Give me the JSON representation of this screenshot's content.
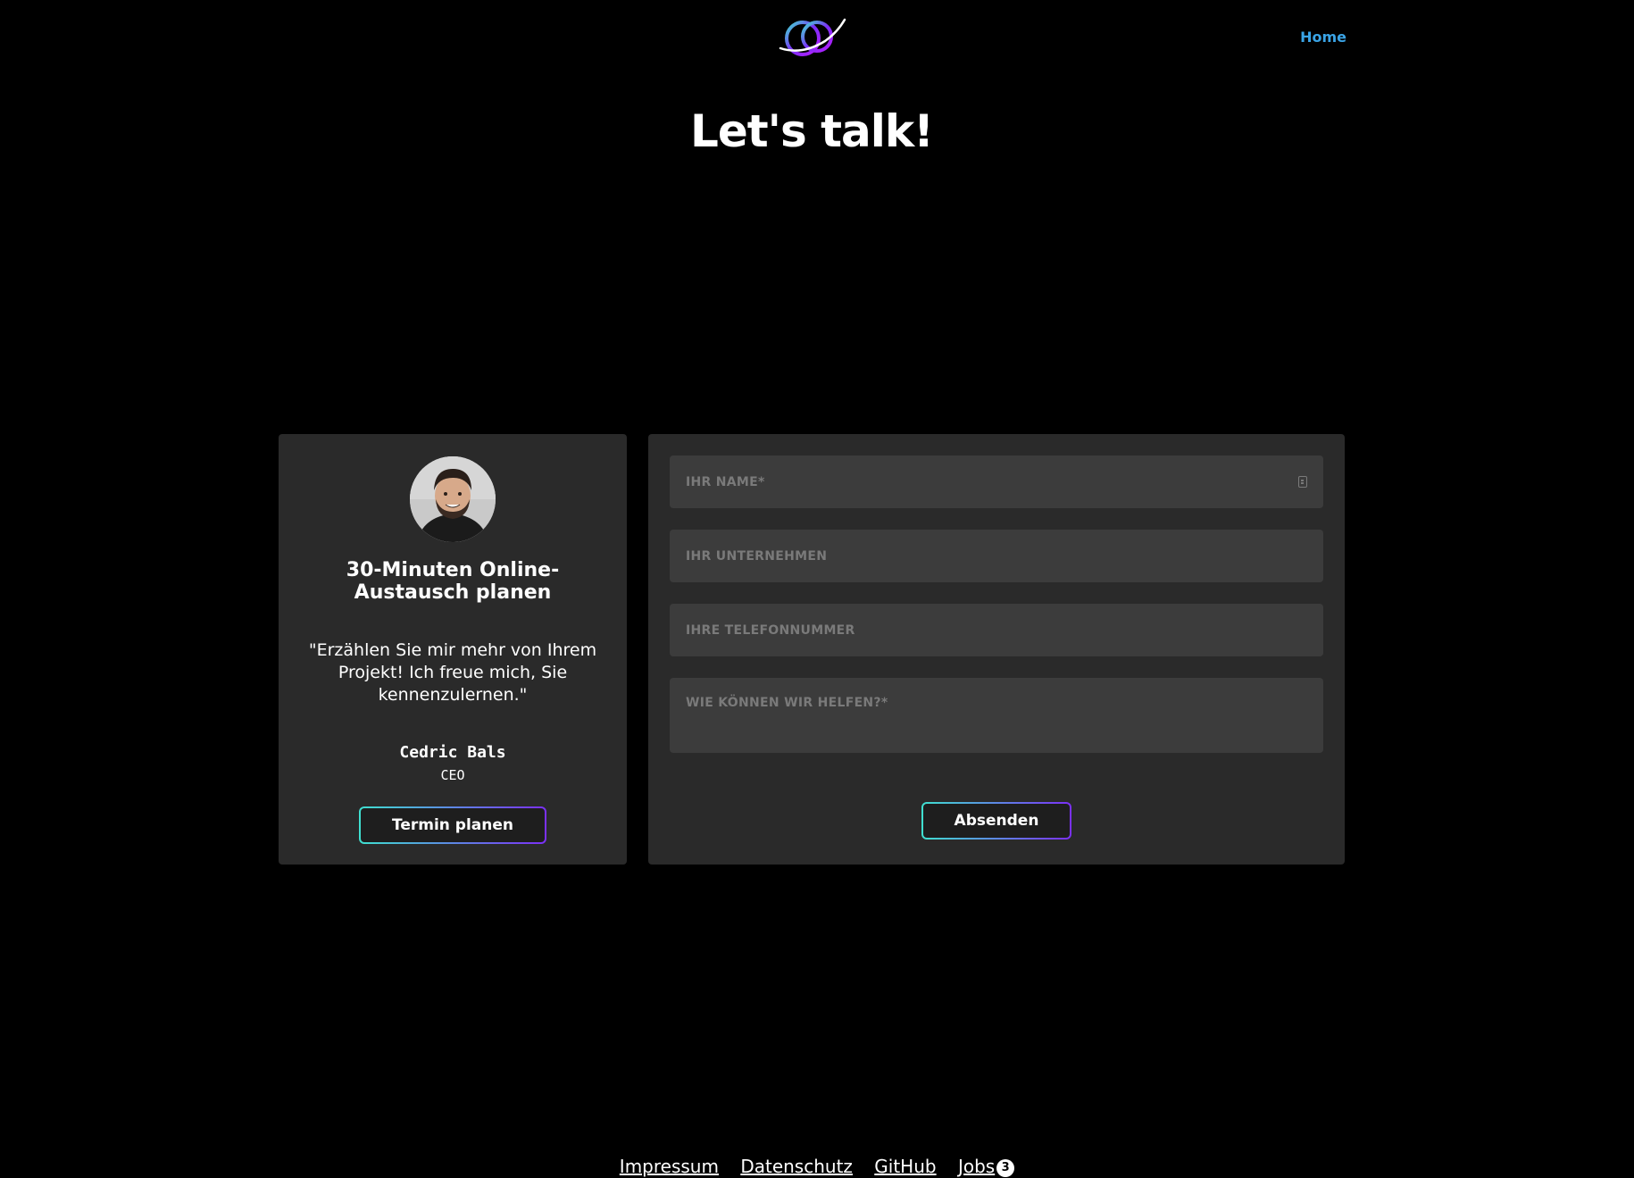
{
  "brand": {
    "accent": "#3aa4e6",
    "logo_gradient": [
      "#3fe0d0",
      "#7b2ff7",
      "#b81cff"
    ],
    "background": "#000000",
    "card_background": "#2a2a2a",
    "field_background": "#3c3c3c"
  },
  "header": {
    "nav": {
      "home_label": "Home"
    }
  },
  "main": {
    "title": "Let's talk!"
  },
  "contact_card": {
    "avatar_icon": "person-photo",
    "title": "30-Minuten Online-Austausch planen",
    "quote": "\"Erzählen Sie mir mehr von Ihrem Projekt! Ich freue mich, Sie kennenzulernen.\"",
    "person": {
      "name": "Cedric Bals",
      "role": "CEO"
    },
    "button_label": "Termin planen"
  },
  "form": {
    "name": {
      "placeholder": "IHR NAME*",
      "value": ""
    },
    "company": {
      "placeholder": "IHR UNTERNEHMEN",
      "value": ""
    },
    "phone": {
      "placeholder": "IHRE TELEFONNUMMER",
      "value": ""
    },
    "message": {
      "placeholder": "WIE KÖNNEN WIR HELFEN?*",
      "value": ""
    },
    "submit_label": "Absenden"
  },
  "footer": {
    "links": {
      "impressum": "Impressum",
      "datenschutz": "Datenschutz",
      "github": "GitHub",
      "jobs": "Jobs"
    },
    "jobs_count": "3"
  }
}
